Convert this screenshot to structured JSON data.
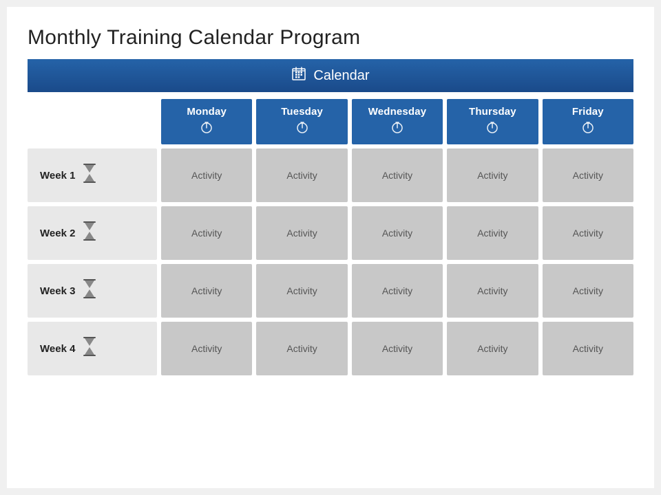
{
  "slide": {
    "title": "Monthly Training Calendar Program",
    "calendarLabel": "Calendar",
    "calendarIcon": "📅",
    "columns": [
      {
        "id": "monday",
        "label": "Monday",
        "icon": "⏱"
      },
      {
        "id": "tuesday",
        "label": "Tuesday",
        "icon": "⏱"
      },
      {
        "id": "wednesday",
        "label": "Wednesday",
        "icon": "⏱"
      },
      {
        "id": "thursday",
        "label": "Thursday",
        "icon": "⏱"
      },
      {
        "id": "friday",
        "label": "Friday",
        "icon": "⏱"
      }
    ],
    "rows": [
      {
        "id": "week1",
        "label": "Week 1",
        "icon": "⌛",
        "cells": [
          "Activity",
          "Activity",
          "Activity",
          "Activity",
          "Activity"
        ]
      },
      {
        "id": "week2",
        "label": "Week 2",
        "icon": "⌛",
        "cells": [
          "Activity",
          "Activity",
          "Activity",
          "Activity",
          "Activity"
        ]
      },
      {
        "id": "week3",
        "label": "Week 3",
        "icon": "⌛",
        "cells": [
          "Activity",
          "Activity",
          "Activity",
          "Activity",
          "Activity"
        ]
      },
      {
        "id": "week4",
        "label": "Week 4",
        "icon": "⌛",
        "cells": [
          "Activity",
          "Activity",
          "Activity",
          "Activity",
          "Activity"
        ]
      }
    ]
  }
}
